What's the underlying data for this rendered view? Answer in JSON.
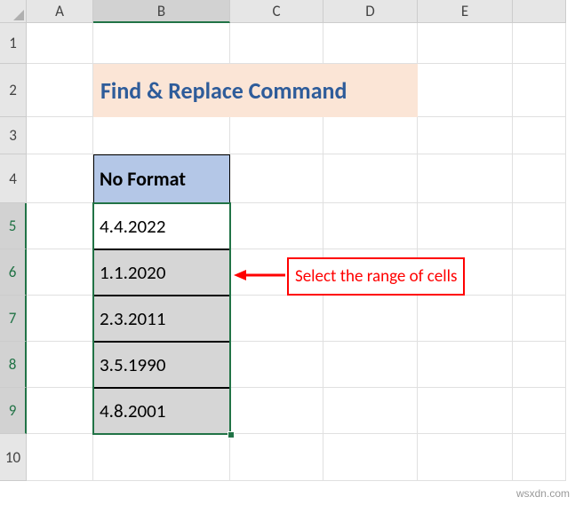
{
  "columns": [
    "A",
    "B",
    "C",
    "D",
    "E"
  ],
  "rows": [
    "1",
    "2",
    "3",
    "4",
    "5",
    "6",
    "7",
    "8",
    "9",
    "10"
  ],
  "active_column": "B",
  "selected_rows": [
    "5",
    "6",
    "7",
    "8",
    "9"
  ],
  "title": "Find & Replace Command",
  "table": {
    "header": "No Format",
    "data": [
      "4.4.2022",
      "1.1.2020",
      "2.3.2011",
      "3.5.1990",
      "4.8.2001"
    ]
  },
  "callout": {
    "text": "Select the range of cells"
  },
  "watermark": "wsxdn.com"
}
